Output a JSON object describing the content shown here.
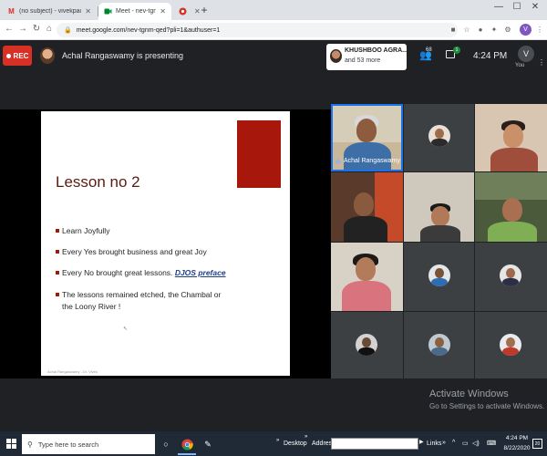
{
  "browser": {
    "tabs": [
      {
        "title": "(no subject) - vivekpachauri@it...",
        "icon": "gmail-icon",
        "active": false
      },
      {
        "title": "Meet - nev-tgnm-qed",
        "icon": "meet-icon",
        "active": true
      },
      {
        "title": "",
        "icon": "record-icon",
        "active": false
      }
    ],
    "new_tab": "+",
    "url": "meet.google.com/nev-tgnm-qed?pli=1&authuser=1",
    "profile_initial": "V"
  },
  "meet": {
    "rec_label": "REC",
    "presenting_text": "Achal Rangaswamy is presenting",
    "joined_name": "KHUSHBOO AGRA...",
    "joined_more": "and 53 more",
    "people_count": "68",
    "chat_badge": "1",
    "time": "4:24 PM",
    "self_initial": "V",
    "self_label": "You",
    "speaker_name": "Achal Rangaswamy"
  },
  "slide": {
    "title": "Lesson no 2",
    "bullets": [
      {
        "text": "Learn Joyfully"
      },
      {
        "text": "Every Yes brought business and great Joy"
      },
      {
        "text": "Every No brought great lessons.",
        "link": "DJOS preface"
      },
      {
        "text": "The lessons remained etched, the Chambal or the Loony River !"
      }
    ],
    "footer": "Achal Rangaswamy - Dr. Vivek"
  },
  "watermark": {
    "line1": "Activate Windows",
    "line2": "Go to Settings to activate Windows."
  },
  "taskbar": {
    "search_placeholder": "Type here to search",
    "desktop_label": "Desktop",
    "address_label": "Address",
    "links_label": "Links",
    "time": "4:24 PM",
    "date": "8/22/2020",
    "notification_count": "20"
  },
  "colors": {
    "accent_red": "#a8170b",
    "rec_red": "#d93025",
    "meet_bg": "#202124"
  }
}
